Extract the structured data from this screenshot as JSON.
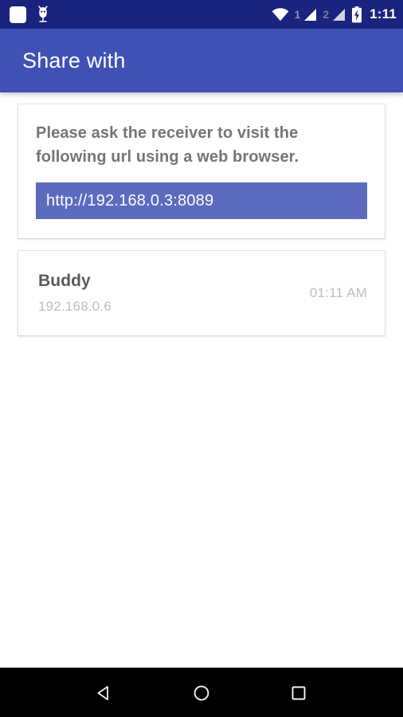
{
  "status_bar": {
    "background": "#1a237e",
    "notification_icon": "notification-square-icon",
    "debug_icon": "android-bug-icon",
    "wifi_icon": "wifi-icon",
    "sim1_label": "1",
    "sim1_icon": "cellular-signal-icon",
    "sim2_label": "2",
    "sim2_icon": "cellular-signal-icon",
    "battery_icon": "battery-charging-icon",
    "time": "1:11"
  },
  "app_bar": {
    "title": "Share with",
    "background": "#3f51b5"
  },
  "url_card": {
    "instruction": "Please ask the receiver to visit the following url using a web browser.",
    "url": "http://192.168.0.3:8089",
    "url_highlight_color": "#5c6bc0"
  },
  "peers": [
    {
      "name": "Buddy",
      "ip": "192.168.0.6",
      "time": "01:11 AM"
    }
  ],
  "nav_bar": {
    "back": "back-icon",
    "home": "home-icon",
    "recents": "recents-icon",
    "background": "#000000"
  }
}
